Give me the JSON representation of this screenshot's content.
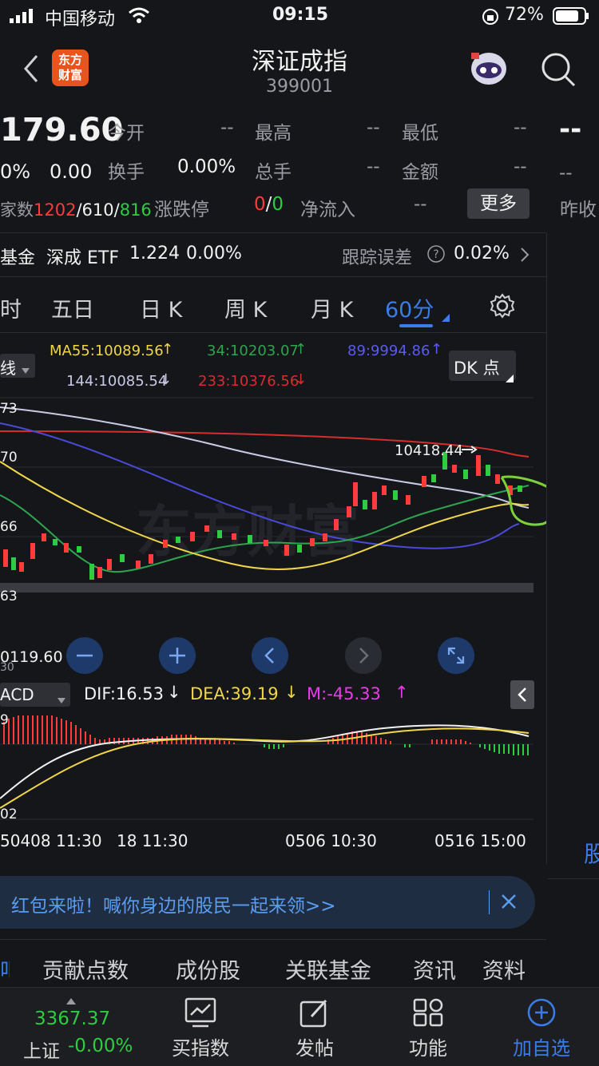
{
  "status": {
    "carrier": "中国移动",
    "time": "09:15",
    "battery": "72%"
  },
  "header": {
    "title": "深证成指",
    "code": "399001",
    "logo_line1": "东方",
    "logo_line2": "财富"
  },
  "quote": {
    "price": "179.60",
    "pct": "0%",
    "change": "0.00",
    "open_label": "今开",
    "open_val": "--",
    "high_label": "最高",
    "high_val": "--",
    "low_label": "最低",
    "low_val": "--",
    "turnover_label": "换手",
    "turnover_val": "0.00%",
    "vol_label": "总手",
    "vol_val": "--",
    "amount_label": "金额",
    "amount_val": "--",
    "right_top": "--",
    "right_mid": "--",
    "count_prefix": "家数",
    "count_up": "1202",
    "count_sep1": "/",
    "count_flat": "610",
    "count_sep2": "/",
    "count_down": "816",
    "limit_label": "涨跌停",
    "limit_up": "0",
    "limit_sep": "/",
    "limit_down": "0",
    "netflow_label": "净流入",
    "netflow_val": "--",
    "more_btn": "更多",
    "prev_close": "昨收"
  },
  "fund": {
    "label1": "基金",
    "etf_name": "深成 ETF",
    "etf_price": "1.224",
    "etf_pct": "0.00%",
    "track_label": "跟踪误差",
    "track_val": "0.02%"
  },
  "tabs": [
    "时",
    "五日",
    "日 K",
    "周 K",
    "月 K",
    "60分"
  ],
  "ma": {
    "ma55": "MA55:10089.56",
    "ma34": "34:10203.07",
    "ma89": "89:9994.86",
    "ma144": "144:10085.54",
    "ma233": "233:10376.56",
    "line_label": "线",
    "dk_btn": "DK 点"
  },
  "chart_labels": {
    "y1": "73",
    "y2": "70",
    "y3": "66",
    "y4": "63",
    "peak": "10418.44",
    "cursor_val": "0119.60",
    "cursor_sub": "30"
  },
  "macd": {
    "label": "ACD",
    "dif": "DIF:16.53",
    "dea": "DEA:39.19",
    "m": "M:-45.33",
    "y_top": "9",
    "y_bot": "02"
  },
  "dates": {
    "d1": "50408 11:30",
    "d2": "18 11:30",
    "d3": "0506 10:30",
    "d4": "0516 15:00",
    "right_tab": "股"
  },
  "banner": {
    "text": "红包来啦！喊你身边的股民一起来领>>"
  },
  "subtabs": [
    "吧",
    "贡献点数",
    "成份股",
    "关联基金",
    "资讯",
    "资料"
  ],
  "bottom": {
    "index_val": "3367.37",
    "index_name": "上证",
    "index_pct": "-0.00%",
    "buy": "买指数",
    "post": "发帖",
    "func": "功能",
    "watch": "加自选"
  },
  "colors": {
    "bg": "#15161a",
    "red": "#ff3b3b",
    "green": "#2ecc40",
    "blue": "#3b7ce6",
    "ma_yellow": "#f0d64a",
    "ma_white": "#c9cbe6",
    "ma_blue": "#4a4ad8",
    "ma_red": "#d62d2d",
    "ma_green": "#2ea44f"
  },
  "chart_data": {
    "type": "line",
    "title": "",
    "series": [
      {
        "name": "MA55",
        "values": [
          10150,
          10120,
          10080,
          10040,
          10030,
          10050,
          10090,
          10140,
          10180,
          10200
        ]
      },
      {
        "name": "34",
        "values": [
          10120,
          10060,
          10000,
          9990,
          10010,
          10060,
          10130,
          10190,
          10220,
          10230
        ]
      },
      {
        "name": "89",
        "values": [
          10320,
          10260,
          10190,
          10120,
          10060,
          10010,
          9995,
          10010,
          10040,
          10060
        ]
      },
      {
        "name": "144",
        "values": [
          10380,
          10330,
          10280,
          10230,
          10190,
          10150,
          10120,
          10100,
          10090,
          10085
        ]
      },
      {
        "name": "233",
        "values": [
          10400,
          10400,
          10395,
          10392,
          10390,
          10388,
          10385,
          10382,
          10378,
          10376
        ]
      }
    ]
  }
}
